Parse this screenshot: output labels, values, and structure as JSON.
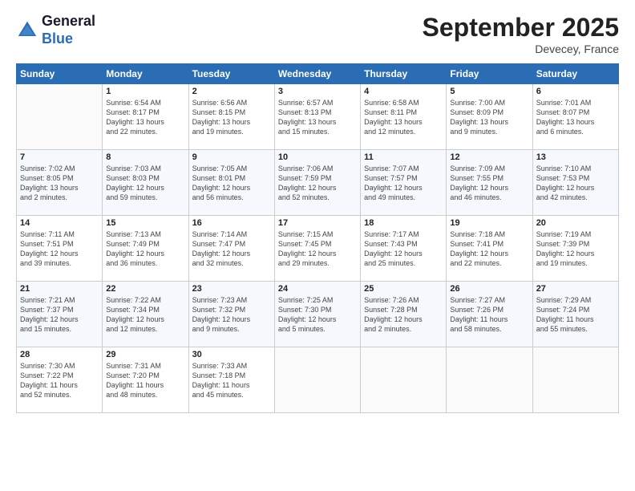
{
  "header": {
    "logo_line1": "General",
    "logo_line2": "Blue",
    "month": "September 2025",
    "location": "Devecey, France"
  },
  "days_of_week": [
    "Sunday",
    "Monday",
    "Tuesday",
    "Wednesday",
    "Thursday",
    "Friday",
    "Saturday"
  ],
  "weeks": [
    [
      {
        "day": "",
        "info": ""
      },
      {
        "day": "1",
        "info": "Sunrise: 6:54 AM\nSunset: 8:17 PM\nDaylight: 13 hours\nand 22 minutes."
      },
      {
        "day": "2",
        "info": "Sunrise: 6:56 AM\nSunset: 8:15 PM\nDaylight: 13 hours\nand 19 minutes."
      },
      {
        "day": "3",
        "info": "Sunrise: 6:57 AM\nSunset: 8:13 PM\nDaylight: 13 hours\nand 15 minutes."
      },
      {
        "day": "4",
        "info": "Sunrise: 6:58 AM\nSunset: 8:11 PM\nDaylight: 13 hours\nand 12 minutes."
      },
      {
        "day": "5",
        "info": "Sunrise: 7:00 AM\nSunset: 8:09 PM\nDaylight: 13 hours\nand 9 minutes."
      },
      {
        "day": "6",
        "info": "Sunrise: 7:01 AM\nSunset: 8:07 PM\nDaylight: 13 hours\nand 6 minutes."
      }
    ],
    [
      {
        "day": "7",
        "info": "Sunrise: 7:02 AM\nSunset: 8:05 PM\nDaylight: 13 hours\nand 2 minutes."
      },
      {
        "day": "8",
        "info": "Sunrise: 7:03 AM\nSunset: 8:03 PM\nDaylight: 12 hours\nand 59 minutes."
      },
      {
        "day": "9",
        "info": "Sunrise: 7:05 AM\nSunset: 8:01 PM\nDaylight: 12 hours\nand 56 minutes."
      },
      {
        "day": "10",
        "info": "Sunrise: 7:06 AM\nSunset: 7:59 PM\nDaylight: 12 hours\nand 52 minutes."
      },
      {
        "day": "11",
        "info": "Sunrise: 7:07 AM\nSunset: 7:57 PM\nDaylight: 12 hours\nand 49 minutes."
      },
      {
        "day": "12",
        "info": "Sunrise: 7:09 AM\nSunset: 7:55 PM\nDaylight: 12 hours\nand 46 minutes."
      },
      {
        "day": "13",
        "info": "Sunrise: 7:10 AM\nSunset: 7:53 PM\nDaylight: 12 hours\nand 42 minutes."
      }
    ],
    [
      {
        "day": "14",
        "info": "Sunrise: 7:11 AM\nSunset: 7:51 PM\nDaylight: 12 hours\nand 39 minutes."
      },
      {
        "day": "15",
        "info": "Sunrise: 7:13 AM\nSunset: 7:49 PM\nDaylight: 12 hours\nand 36 minutes."
      },
      {
        "day": "16",
        "info": "Sunrise: 7:14 AM\nSunset: 7:47 PM\nDaylight: 12 hours\nand 32 minutes."
      },
      {
        "day": "17",
        "info": "Sunrise: 7:15 AM\nSunset: 7:45 PM\nDaylight: 12 hours\nand 29 minutes."
      },
      {
        "day": "18",
        "info": "Sunrise: 7:17 AM\nSunset: 7:43 PM\nDaylight: 12 hours\nand 25 minutes."
      },
      {
        "day": "19",
        "info": "Sunrise: 7:18 AM\nSunset: 7:41 PM\nDaylight: 12 hours\nand 22 minutes."
      },
      {
        "day": "20",
        "info": "Sunrise: 7:19 AM\nSunset: 7:39 PM\nDaylight: 12 hours\nand 19 minutes."
      }
    ],
    [
      {
        "day": "21",
        "info": "Sunrise: 7:21 AM\nSunset: 7:37 PM\nDaylight: 12 hours\nand 15 minutes."
      },
      {
        "day": "22",
        "info": "Sunrise: 7:22 AM\nSunset: 7:34 PM\nDaylight: 12 hours\nand 12 minutes."
      },
      {
        "day": "23",
        "info": "Sunrise: 7:23 AM\nSunset: 7:32 PM\nDaylight: 12 hours\nand 9 minutes."
      },
      {
        "day": "24",
        "info": "Sunrise: 7:25 AM\nSunset: 7:30 PM\nDaylight: 12 hours\nand 5 minutes."
      },
      {
        "day": "25",
        "info": "Sunrise: 7:26 AM\nSunset: 7:28 PM\nDaylight: 12 hours\nand 2 minutes."
      },
      {
        "day": "26",
        "info": "Sunrise: 7:27 AM\nSunset: 7:26 PM\nDaylight: 11 hours\nand 58 minutes."
      },
      {
        "day": "27",
        "info": "Sunrise: 7:29 AM\nSunset: 7:24 PM\nDaylight: 11 hours\nand 55 minutes."
      }
    ],
    [
      {
        "day": "28",
        "info": "Sunrise: 7:30 AM\nSunset: 7:22 PM\nDaylight: 11 hours\nand 52 minutes."
      },
      {
        "day": "29",
        "info": "Sunrise: 7:31 AM\nSunset: 7:20 PM\nDaylight: 11 hours\nand 48 minutes."
      },
      {
        "day": "30",
        "info": "Sunrise: 7:33 AM\nSunset: 7:18 PM\nDaylight: 11 hours\nand 45 minutes."
      },
      {
        "day": "",
        "info": ""
      },
      {
        "day": "",
        "info": ""
      },
      {
        "day": "",
        "info": ""
      },
      {
        "day": "",
        "info": ""
      }
    ]
  ]
}
